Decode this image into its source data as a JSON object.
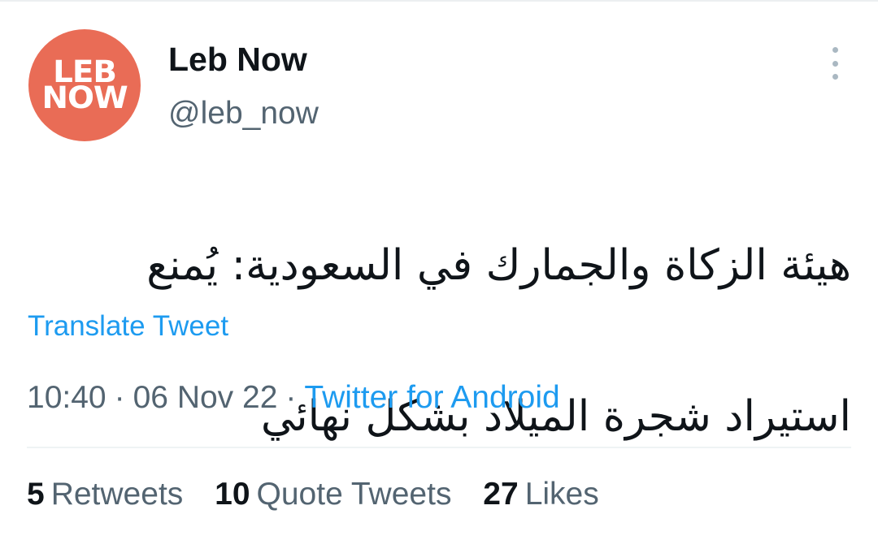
{
  "account": {
    "display_name": "Leb Now",
    "handle": "@leb_now",
    "avatar_line1": "LEB",
    "avatar_line2": "NOW",
    "avatar_color": "#e96c56"
  },
  "tweet": {
    "text_line1": "هيئة الزكاة والجمارك في السعودية: يُمنع",
    "text_line2": "استيراد شجرة الميلاد بشكل نهائي",
    "translate_label": "Translate Tweet",
    "time": "10:40",
    "date": "06 Nov 22",
    "separator": "·",
    "source": "Twitter for Android"
  },
  "stats": {
    "retweets_count": "5",
    "retweets_label": "Retweets",
    "quotes_count": "10",
    "quotes_label": "Quote Tweets",
    "likes_count": "27",
    "likes_label": "Likes"
  },
  "colors": {
    "link": "#1d9bf0",
    "secondary_text": "#536471",
    "primary_text": "#0f1419"
  },
  "icons": {
    "more": "more-vertical-icon"
  }
}
